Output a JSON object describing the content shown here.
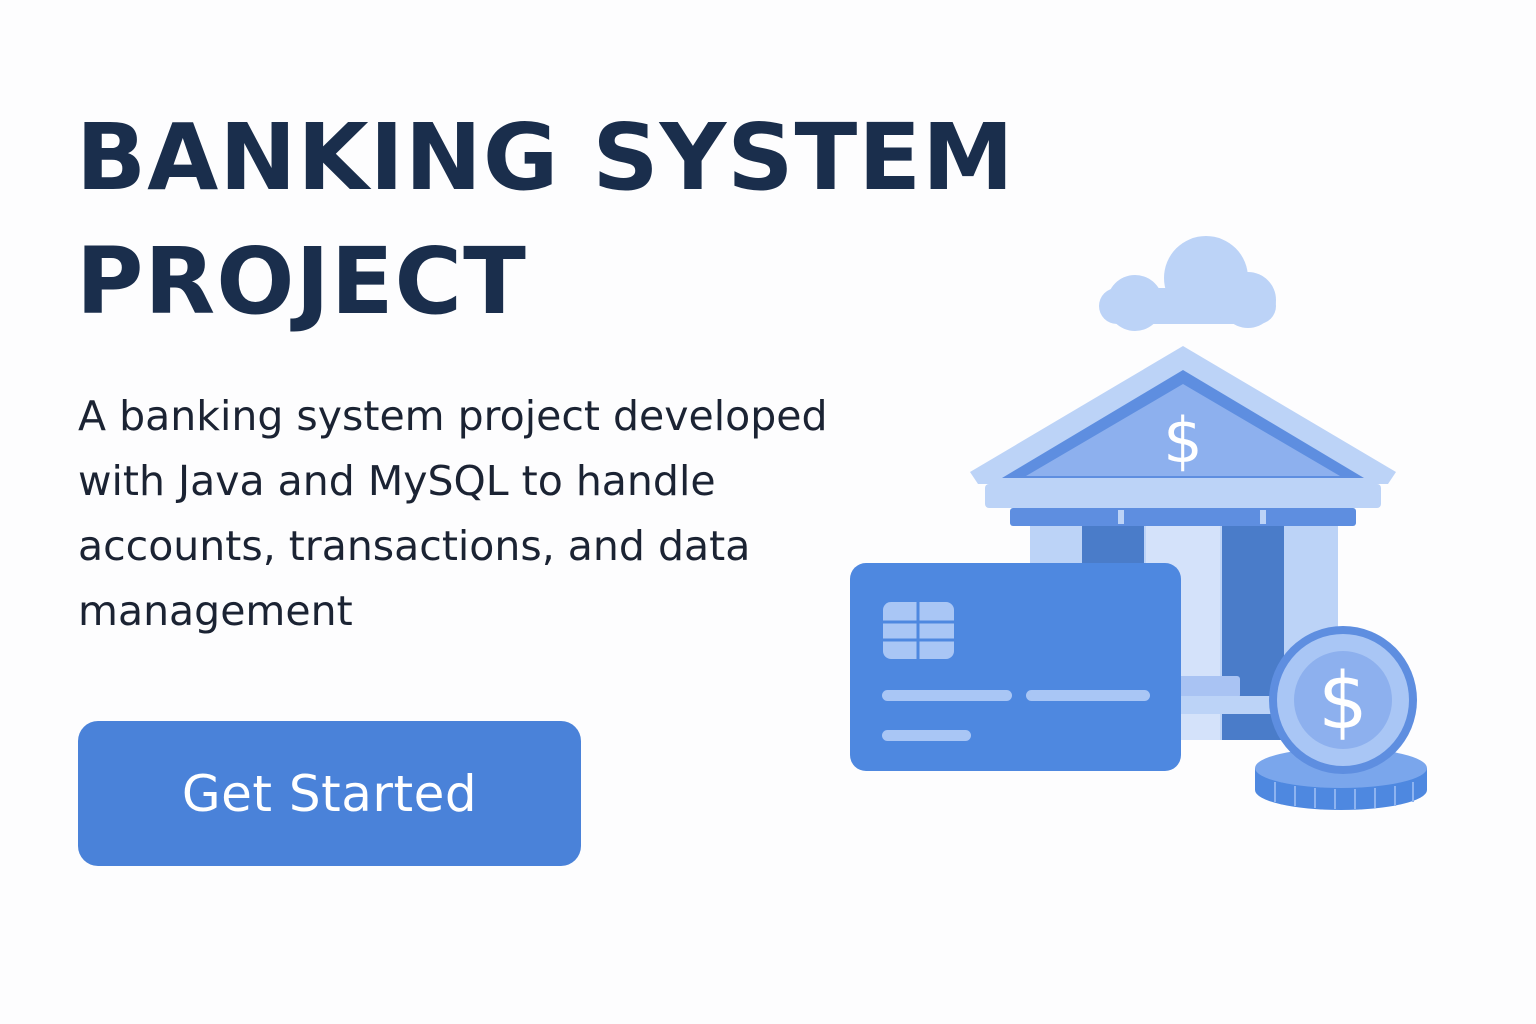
{
  "hero": {
    "title_line1": "BANKING SYSTEM",
    "title_line2": "PROJECT",
    "description": "A banking system project developed with Java and MySQL to handle accounts, transactions, and data management",
    "cta_label": "Get Started"
  },
  "illustration": {
    "icons": [
      "cloud-icon",
      "bank-building-icon",
      "dollar-sign-icon",
      "credit-card-icon",
      "card-chip-icon",
      "coin-icon",
      "coin-stack-icon"
    ],
    "dollar_glyph": "$"
  },
  "colors": {
    "background": "#fdfdfe",
    "title": "#1a2e4c",
    "body_text": "#1b2333",
    "accent": "#4a82d9",
    "light_blue": "#bcd3f7",
    "mid_blue": "#8db0ee",
    "dark_blue": "#4575c2"
  }
}
